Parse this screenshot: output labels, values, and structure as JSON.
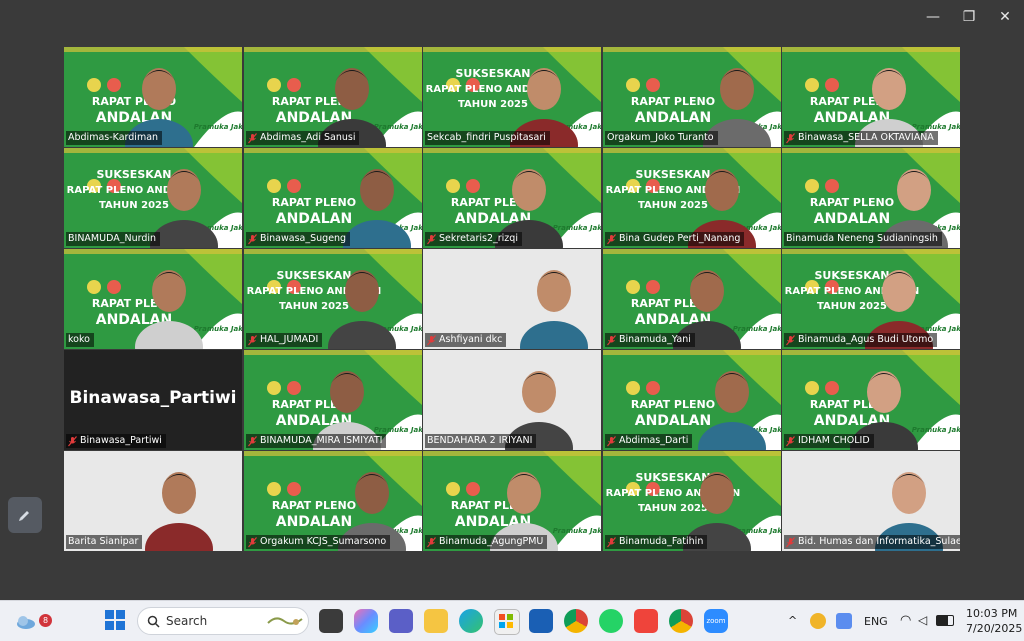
{
  "window": {
    "minimize_glyph": "—",
    "restore_glyph": "❐",
    "close_glyph": "✕"
  },
  "banner": {
    "line1": "RAPAT PLENO",
    "line2": "ANDALAN",
    "brand": "Pramuka Jaksel",
    "alt_line1": "SUKSESKAN",
    "alt_line2": "RAPAT PLENO ANDALAN",
    "alt_line3": "TAHUN 2025"
  },
  "participants": [
    {
      "name": "Abdimas-Kardiman",
      "muted": false
    },
    {
      "name": "Abdimas_Adi Sanusi",
      "muted": true
    },
    {
      "name": "Sekcab_findri Puspitasari",
      "muted": false
    },
    {
      "name": "Orgakum_Joko Turanto",
      "muted": false
    },
    {
      "name": "Binawasa_SELLA OKTAVIANA",
      "muted": true
    },
    {
      "name": "BINAMUDA_Nurdin",
      "muted": false
    },
    {
      "name": "Binawasa_Sugeng",
      "muted": true
    },
    {
      "name": "Sekretaris2_rizqi",
      "muted": true
    },
    {
      "name": "Bina Gudep Perti_Nanang",
      "muted": true
    },
    {
      "name": "Binamuda Neneng Sudianingsih",
      "muted": false
    },
    {
      "name": "koko",
      "muted": false
    },
    {
      "name": "HAL_JUMADI",
      "muted": true
    },
    {
      "name": "Ashfiyani dkc",
      "muted": true
    },
    {
      "name": "Binamuda_Yani",
      "muted": true
    },
    {
      "name": "Binamuda_Agus Budi Utomo",
      "muted": true
    },
    {
      "name": "Binawasa_Partiwi",
      "muted": true
    },
    {
      "name": "BINAMUDA_MIRA ISMIYATI",
      "muted": true
    },
    {
      "name": "BENDAHARA 2 IRIYANI",
      "muted": false
    },
    {
      "name": "Abdimas_Darti",
      "muted": true
    },
    {
      "name": "IDHAM CHOLID",
      "muted": true
    },
    {
      "name": "Barita Sianipar",
      "muted": false
    },
    {
      "name": "Orgakum KCJS_Sumarsono",
      "muted": true
    },
    {
      "name": "Binamuda_AgungPMU",
      "muted": true
    },
    {
      "name": "Binamuda_Fatihin",
      "muted": true
    },
    {
      "name": "Bid. Humas dan Informatika_Sulae...",
      "muted": true
    }
  ],
  "no_video_name": "Binawasa_Partiwi",
  "taskbar": {
    "search_label": "Search",
    "notification_count": "8",
    "language": "ENG",
    "time": "10:03 PM",
    "date": "7/20/2025",
    "apps": [
      "start-icon",
      "task-view-icon",
      "copilot-icon",
      "teams-icon",
      "file-explorer-icon",
      "edge-icon",
      "store-icon",
      "mail-icon",
      "chrome-icon",
      "whatsapp-icon",
      "anydesk-icon",
      "chrome-profile-icon",
      "zoom-icon"
    ],
    "zoom_label": "zoom"
  }
}
